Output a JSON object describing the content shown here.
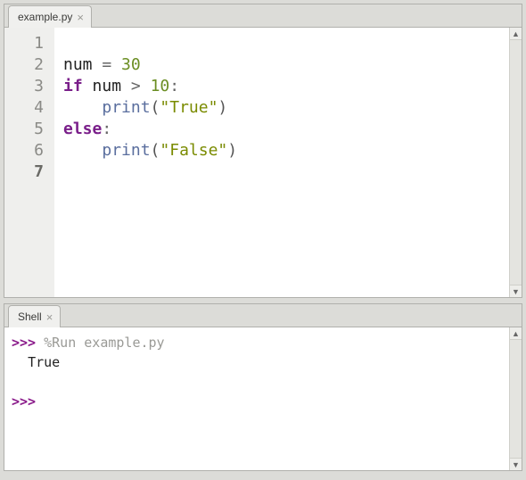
{
  "editor": {
    "tab_label": "example.py",
    "line_numbers": [
      "1",
      "2",
      "3",
      "4",
      "5",
      "6",
      "7"
    ],
    "current_line_index": 6,
    "code": {
      "l1": "",
      "l2_name": "num",
      "l2_eq": " = ",
      "l2_val": "30",
      "l3_if": "if",
      "l3_sp1": " ",
      "l3_name": "num",
      "l3_sp2": " ",
      "l3_op": ">",
      "l3_sp3": " ",
      "l3_val": "10",
      "l3_colon": ":",
      "l4_indent": "    ",
      "l4_func": "print",
      "l4_open": "(",
      "l4_str": "\"True\"",
      "l4_close": ")",
      "l5_else": "else",
      "l5_colon": ":",
      "l6_indent": "    ",
      "l6_func": "print",
      "l6_open": "(",
      "l6_str": "\"False\"",
      "l6_close": ")",
      "l7": ""
    }
  },
  "shell": {
    "tab_label": "Shell",
    "prompt": ">>>",
    "run_command": " %Run example.py",
    "output_indent": "  ",
    "output": "True",
    "prompt2": ">>>",
    "after_prompt2": " "
  }
}
